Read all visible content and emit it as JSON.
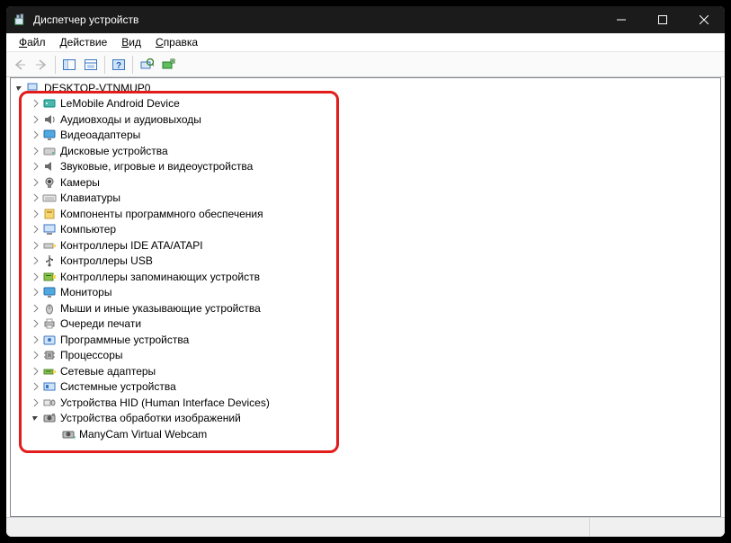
{
  "window": {
    "title": "Диспетчер устройств"
  },
  "menu": {
    "file": "Файл",
    "action": "Действие",
    "view": "Вид",
    "help": "Справка"
  },
  "tree": {
    "root": "DESKTOP-VTNMUP0",
    "items": [
      "LeMobile Android Device",
      "Аудиовходы и аудиовыходы",
      "Видеоадаптеры",
      "Дисковые устройства",
      "Звуковые, игровые и видеоустройства",
      "Камеры",
      "Клавиатуры",
      "Компоненты программного обеспечения",
      "Компьютер",
      "Контроллеры IDE ATA/ATAPI",
      "Контроллеры USB",
      "Контроллеры запоминающих устройств",
      "Мониторы",
      "Мыши и иные указывающие устройства",
      "Очереди печати",
      "Программные устройства",
      "Процессоры",
      "Сетевые адаптеры",
      "Системные устройства",
      "Устройства HID (Human Interface Devices)",
      "Устройства обработки изображений"
    ],
    "child": "ManyCam Virtual Webcam"
  }
}
